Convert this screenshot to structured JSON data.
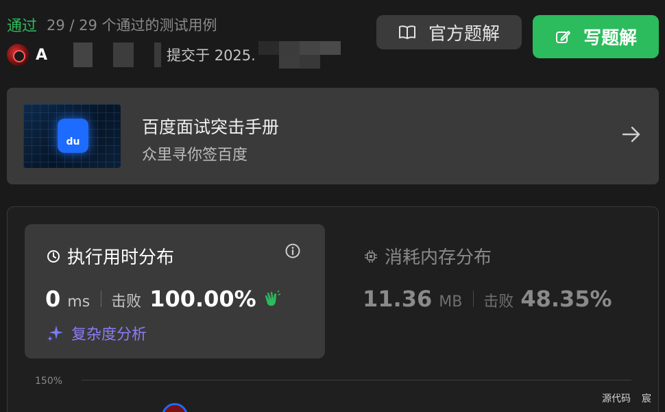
{
  "status": {
    "label": "通过",
    "count_text": "29 / 29 个通过的测试用例",
    "color": "#2cbb5d"
  },
  "submission": {
    "user_initial": "A",
    "submitted_text": "提交于 2025."
  },
  "buttons": {
    "official_solution": "官方题解",
    "write_solution": "写题解",
    "write_color": "#2cbb5d"
  },
  "promo": {
    "title": "百度面试突击手册",
    "subtitle": "众里寻你签百度",
    "logo_text": "du"
  },
  "runtime": {
    "title": "执行用时分布",
    "value": "0",
    "unit": "ms",
    "beat_label": "击败",
    "beat_percent": "100.00%",
    "complexity_link": "复杂度分析"
  },
  "memory": {
    "title": "消耗内存分布",
    "value": "11.36",
    "unit": "MB",
    "beat_label": "击败",
    "beat_percent": "48.35%"
  },
  "chart": {
    "axis_label": "150%"
  },
  "corner": {
    "source_link": "源代码",
    "extra_link": "宸"
  },
  "icons": {
    "official": "book-open-icon",
    "write": "edit-icon",
    "arrow": "arrow-right-icon",
    "clock": "clock-icon",
    "info": "info-icon",
    "chip": "chip-icon",
    "sparkle": "sparkle-icon",
    "clap": "clap-icon"
  }
}
